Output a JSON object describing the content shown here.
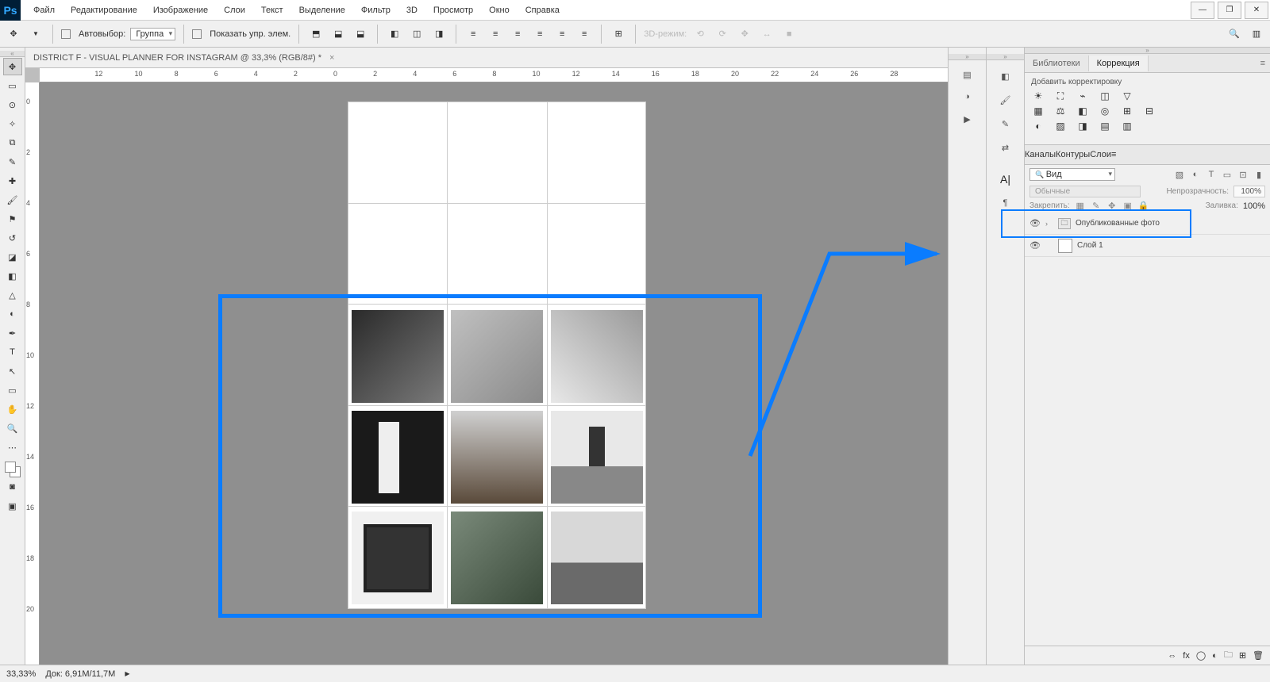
{
  "menu": {
    "items": [
      "Файл",
      "Редактирование",
      "Изображение",
      "Слои",
      "Текст",
      "Выделение",
      "Фильтр",
      "3D",
      "Просмотр",
      "Окно",
      "Справка"
    ]
  },
  "options": {
    "autoselect": "Автовыбор:",
    "autoselect_value": "Группа",
    "showcontrols": "Показать упр. элем.",
    "mode3d": "3D-режим:"
  },
  "document": {
    "title": "DISTRICT F -  VISUAL PLANNER FOR INSTAGRAM @ 33,3% (RGB/8#) *"
  },
  "rulerH": [
    -12,
    -10,
    -8,
    -6,
    -4,
    -2,
    0,
    2,
    4,
    6,
    8,
    10,
    12,
    14,
    16,
    18,
    20,
    22,
    24,
    26,
    28
  ],
  "rulerV": [
    0,
    2,
    4,
    6,
    8,
    10,
    12,
    14,
    16,
    18,
    20
  ],
  "panels": {
    "libraries": "Библиотеки",
    "correction": "Коррекция",
    "addadj": "Добавить корректировку",
    "channels": "Каналы",
    "paths": "Контуры",
    "layers": "Слои",
    "kind": "Вид",
    "blend": "Обычные",
    "opacity_lbl": "Непрозрачность:",
    "opacity_val": "100%",
    "fill_lbl": "Заливка:",
    "fill_val": "100%",
    "lock_lbl": "Закрепить:"
  },
  "layers": {
    "group": "Опубликованные фото",
    "layer1": "Слой 1"
  },
  "status": {
    "zoom": "33,33%",
    "doc": "Док: 6,91M/11,7M"
  }
}
